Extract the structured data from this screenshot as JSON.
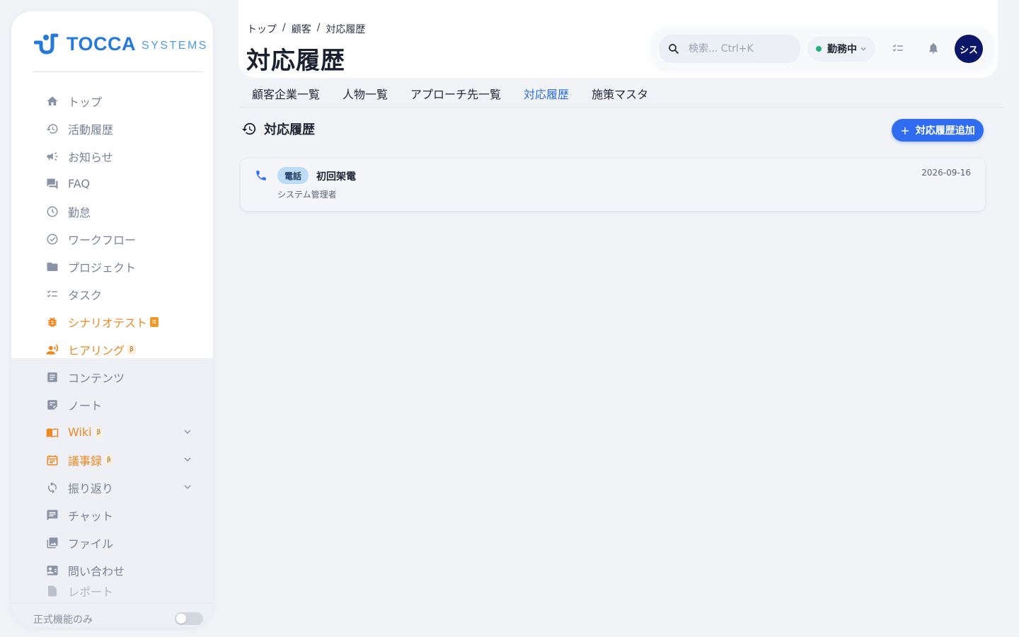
{
  "brand": {
    "name": "TOCCA",
    "sub": "SYSTEMS",
    "primary_color": "#2679d6"
  },
  "sidebar": {
    "items": [
      {
        "label": "トップ",
        "icon": "home-icon"
      },
      {
        "label": "活動履歴",
        "icon": "history-icon"
      },
      {
        "label": "お知らせ",
        "icon": "megaphone-icon"
      },
      {
        "label": "FAQ",
        "icon": "forum-icon"
      },
      {
        "label": "勤怠",
        "icon": "clock-icon"
      },
      {
        "label": "ワークフロー",
        "icon": "check-circle-icon"
      },
      {
        "label": "プロジェクト",
        "icon": "folder-icon"
      },
      {
        "label": "タスク",
        "icon": "checklist-icon"
      },
      {
        "label": "シナリオテスト",
        "icon": "bug-icon",
        "badge": "α"
      },
      {
        "label": "ヒアリング",
        "icon": "record-voice-icon",
        "badge": "β"
      },
      {
        "label": "コンテンツ",
        "icon": "article-icon"
      },
      {
        "label": "ノート",
        "icon": "note-icon"
      },
      {
        "label": "Wiki",
        "icon": "book-icon",
        "badge": "β"
      },
      {
        "label": "議事録",
        "icon": "calendar-icon",
        "badge": "β"
      },
      {
        "label": "振り返り",
        "icon": "refresh-icon"
      },
      {
        "label": "チャット",
        "icon": "chat-icon"
      },
      {
        "label": "ファイル",
        "icon": "image-icon"
      },
      {
        "label": "問い合わせ",
        "icon": "contact-card-icon"
      },
      {
        "label": "レポート",
        "icon": "report-icon"
      }
    ],
    "footer_label": "正式機能のみ",
    "footer_toggle_on": false
  },
  "header": {
    "breadcrumb": [
      "トップ",
      "顧客",
      "対応履歴"
    ],
    "title": "対応履歴",
    "search_placeholder": "検索... Ctrl+K",
    "status_label": "勤務中",
    "status_color": "#22b07d",
    "avatar_initials": "シス"
  },
  "tabs": [
    {
      "label": "顧客企業一覧",
      "active": false
    },
    {
      "label": "人物一覧",
      "active": false
    },
    {
      "label": "アプローチ先一覧",
      "active": false
    },
    {
      "label": "対応履歴",
      "active": true
    },
    {
      "label": "施策マスタ",
      "active": false
    }
  ],
  "section": {
    "title": "対応履歴",
    "add_button_label": "対応履歴追加",
    "accent_color": "#2f6cf0"
  },
  "records": [
    {
      "type_label": "電話",
      "title": "初回架電",
      "owner": "システム管理者",
      "date": "2026-09-16"
    }
  ]
}
